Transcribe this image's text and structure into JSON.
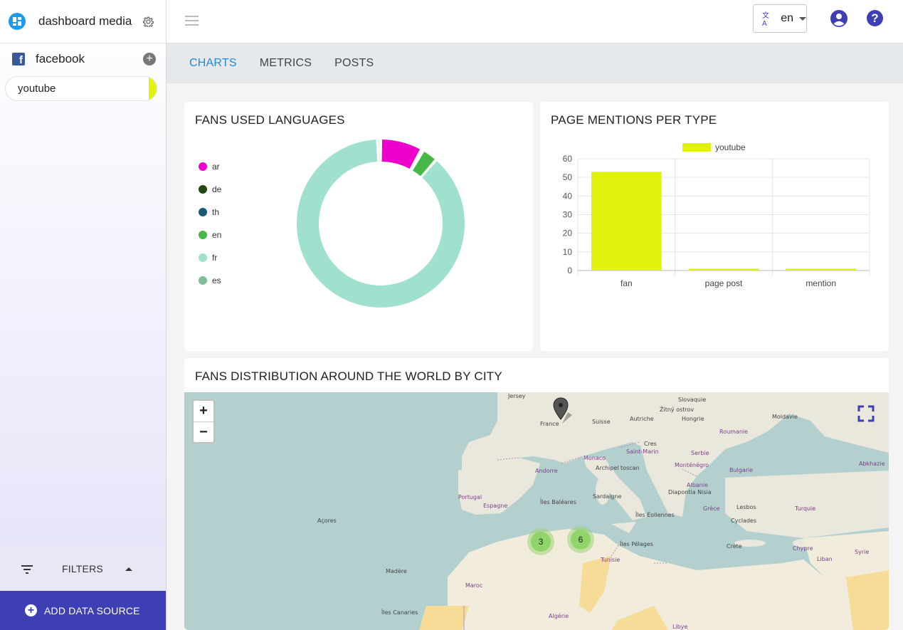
{
  "app": {
    "title": "dashboard media"
  },
  "sidebar": {
    "accounts": [
      {
        "label": "facebook"
      },
      {
        "label": "youtube",
        "color": "#e2f20f"
      }
    ],
    "filters_label": "FILTERS",
    "add_source_label": "ADD DATA SOURCE"
  },
  "header": {
    "language": "en",
    "lang_icon": "文A"
  },
  "tabs": [
    {
      "label": "CHARTS",
      "active": true
    },
    {
      "label": "METRICS",
      "active": false
    },
    {
      "label": "POSTS",
      "active": false
    }
  ],
  "languages_card": {
    "title": "FANS USED LANGUAGES",
    "chart_data": {
      "type": "pie",
      "variant": "doughnut",
      "labels": [
        "ar",
        "de",
        "th",
        "en",
        "fr",
        "es"
      ],
      "values": [
        8,
        0.2,
        0.2,
        3,
        88,
        0.6
      ],
      "colors": [
        "#ee00cc",
        "#1f4a10",
        "#1b5875",
        "#47b847",
        "#a0e0cf",
        "#7fbe98"
      ],
      "legend": "left"
    }
  },
  "mentions_card": {
    "title": "PAGE MENTIONS PER TYPE",
    "chart_data": {
      "type": "bar",
      "categories": [
        "fan",
        "page post",
        "mention"
      ],
      "series": [
        {
          "name": "youtube",
          "values": [
            53,
            1,
            1
          ],
          "color": "#e2f20f"
        }
      ],
      "ylim": [
        0,
        60
      ],
      "yticks": [
        0,
        10,
        20,
        30,
        40,
        50,
        60
      ],
      "grid": true,
      "legend": "top"
    }
  },
  "map_card": {
    "title": "FANS DISTRIBUTION AROUND THE WORLD BY CITY",
    "zoom_in": "+",
    "zoom_out": "−",
    "clusters": [
      {
        "count": "3"
      },
      {
        "count": "6"
      }
    ],
    "labels": {
      "jersey": "Jersey",
      "slovaquie": "Slovaquie",
      "zitny": "Žitný ostrov",
      "autriche": "Autriche",
      "hongrie": "Hongrie",
      "moldavie": "Moldavie",
      "roumanie": "Roumanie",
      "france": "France",
      "suisse": "Suisse",
      "cres": "Cres",
      "serbie": "Serbie",
      "monaco": "Monaco",
      "saint_marin": "Saint-Marin",
      "archipel": "Archipel toscan",
      "montenegro": "Monténégro",
      "bulgarie": "Bulgarie",
      "andorre": "Andorre",
      "albanie": "Albanie",
      "diapontia": "Diapontia Nisia",
      "abkhazie": "Abkhazie",
      "portugal": "Portugal",
      "espagne": "Espagne",
      "sardaigne": "Sardaigne",
      "baleares": "Îles Baléares",
      "grece": "Grèce",
      "lesbos": "Lesbos",
      "turquie": "Turquie",
      "acores": "Açores",
      "eoliennes": "Îles Éoliennes",
      "cyclades": "Cyclades",
      "pelages": "Îles Pélages",
      "crete": "Crète",
      "chypre": "Chypre",
      "syrie": "Syrie",
      "madere": "Madère",
      "tunisie": "Tunisie",
      "liban": "Liban",
      "maroc": "Maroc",
      "canaries": "Îles Canaries",
      "algerie": "Algérie",
      "libye": "Libye"
    }
  }
}
